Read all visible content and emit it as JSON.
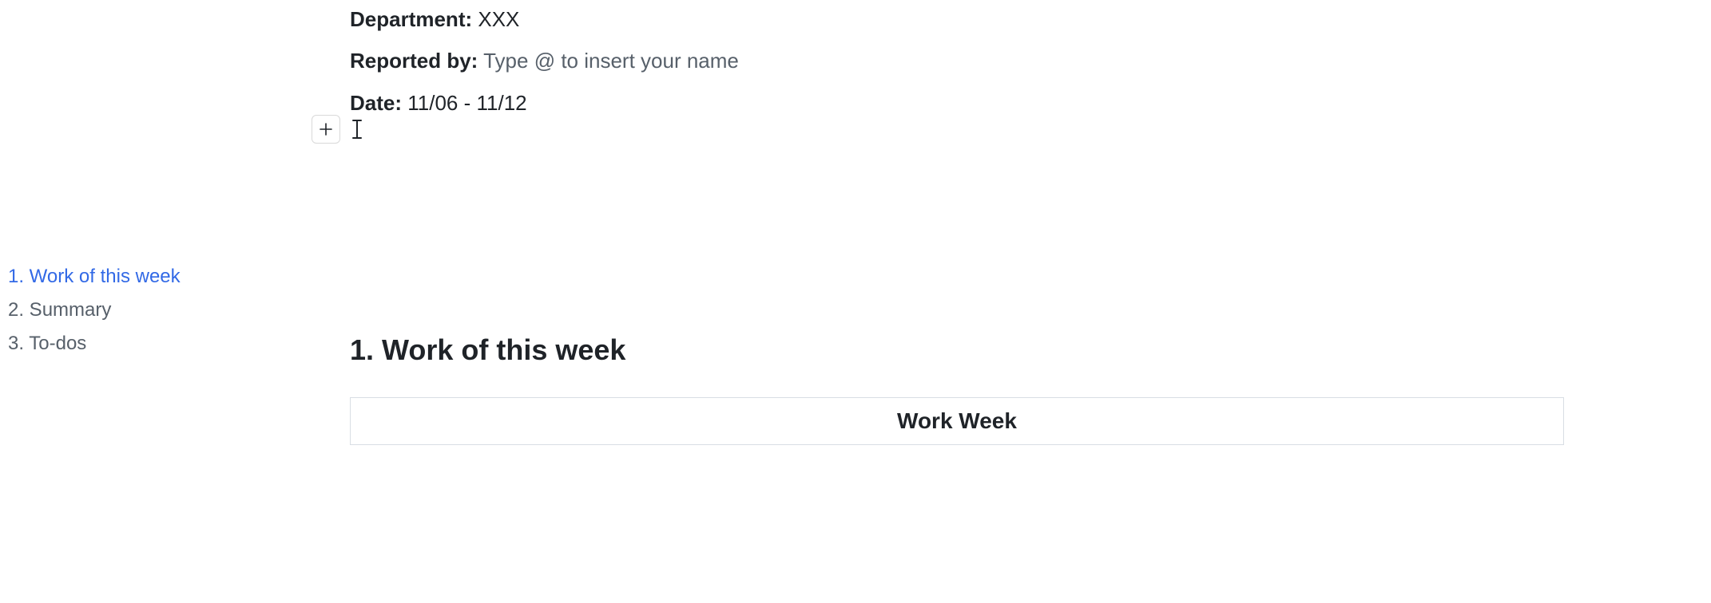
{
  "outline": {
    "items": [
      {
        "label": "1. Work of this week",
        "active": true
      },
      {
        "label": "2. Summary",
        "active": false
      },
      {
        "label": "3. To-dos",
        "active": false
      }
    ]
  },
  "meta": {
    "department_label": "Department:",
    "department_value": "XXX",
    "reported_by_label": "Reported by:",
    "reported_by_placeholder": "Type @ to insert your name",
    "date_label": "Date:",
    "date_value": "11/06 - 11/12"
  },
  "section": {
    "heading": "1. Work of this week",
    "table_header": "Work Week"
  }
}
